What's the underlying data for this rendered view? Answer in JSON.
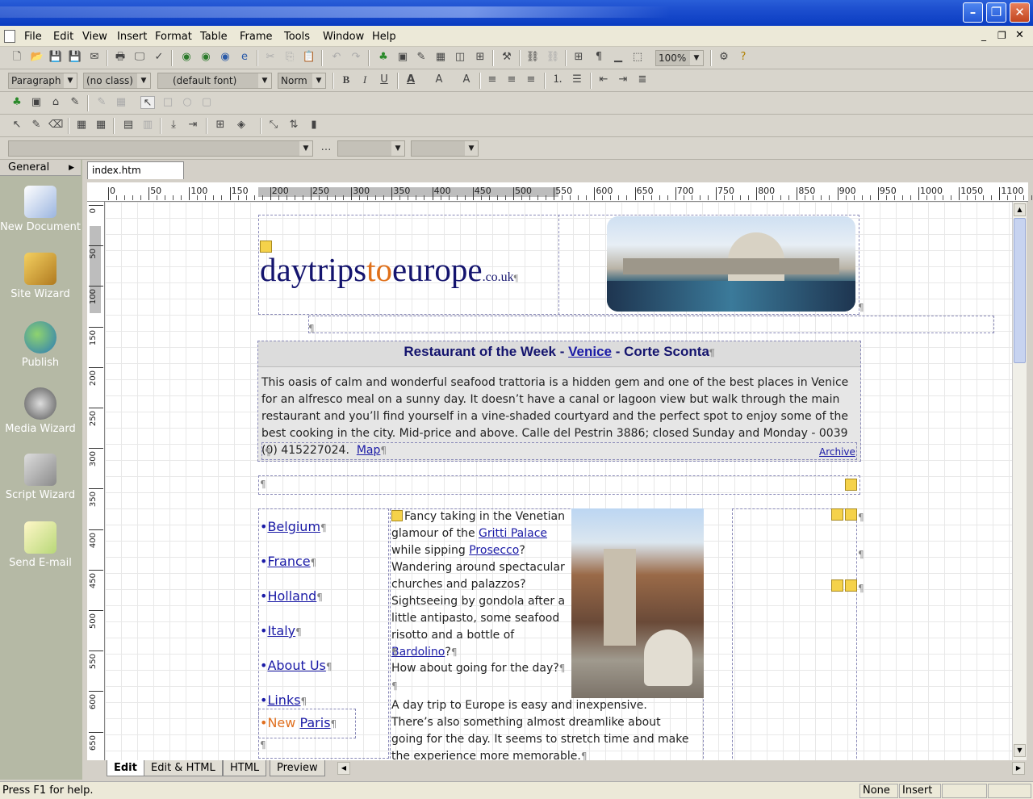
{
  "window": {
    "title": ""
  },
  "menu": [
    "File",
    "Edit",
    "View",
    "Insert",
    "Format",
    "Table",
    "Frame",
    "Tools",
    "Window",
    "Help"
  ],
  "format_bar": {
    "paragraph": "Paragraph",
    "class": "(no class)",
    "font": "(default font)",
    "size": "Norm",
    "zoom": "100%"
  },
  "left_panel": {
    "header": "General",
    "items": [
      "New Document",
      "Site Wizard",
      "Publish",
      "Media Wizard",
      "Script Wizard",
      "Send E-mail"
    ]
  },
  "document_tab": "index.htm",
  "ruler_ticks": [
    "0",
    "50",
    "100",
    "150",
    "200",
    "250",
    "300",
    "350",
    "400",
    "450",
    "500",
    "550",
    "600",
    "650",
    "700",
    "750",
    "800",
    "850",
    "900",
    "950",
    "1000",
    "1050",
    "1100"
  ],
  "vruler_ticks": [
    "0",
    "50",
    "100",
    "150",
    "200",
    "250",
    "300",
    "350",
    "400",
    "450",
    "500",
    "550",
    "600",
    "650"
  ],
  "page": {
    "logo": {
      "part1": "daytrips",
      "part2": "to",
      "part3": "europe",
      "suffix": ".co.uk"
    },
    "restaurant": {
      "title_prefix": "Restaurant of the Week - ",
      "title_link": "Venice",
      "title_suffix": " - Corte Sconta",
      "body": "This oasis of calm and wonderful seafood trattoria is a hidden gem and one of the best places in Venice for an alfresco meal on a sunny day. It doesn’t have a canal or lagoon view but walk through the main restaurant and you’ll find yourself in a vine-shaded courtyard and the perfect spot to enjoy some of the best cooking in the city. Mid-price and above. Calle del Pestrin 3886; closed Sunday and Monday - 0039 (0) 415227024.",
      "map_link": "Map",
      "archive_link": "Archive"
    },
    "nav": [
      "Belgium",
      "France",
      "Holland",
      "Italy",
      "About Us",
      "Links"
    ],
    "new_label": "New",
    "new_link": "Paris",
    "article": {
      "p1_a": "Fancy taking in the Venetian glamour of the ",
      "link1": "Gritti Palace",
      "p1_b": " while sipping ",
      "link2": "Prosecco",
      "p1_c": "? Wandering around spectacular churches and palazzos? Sightseeing by gondola after a little antipasto, some seafood risotto and a bottle of ",
      "link3": "Bardolino",
      "p1_d": "?",
      "p2": "How about going for the day?",
      "p3": "A day trip to Europe is easy and inexpensive. There’s also something almost dreamlike about going for the day. It seems to stretch time and make the experience more memorable."
    }
  },
  "view_tabs": [
    "Edit",
    "Edit & HTML",
    "HTML",
    "Preview"
  ],
  "status": {
    "help": "Press F1 for help.",
    "pane1": "None",
    "pane2": "Insert"
  }
}
